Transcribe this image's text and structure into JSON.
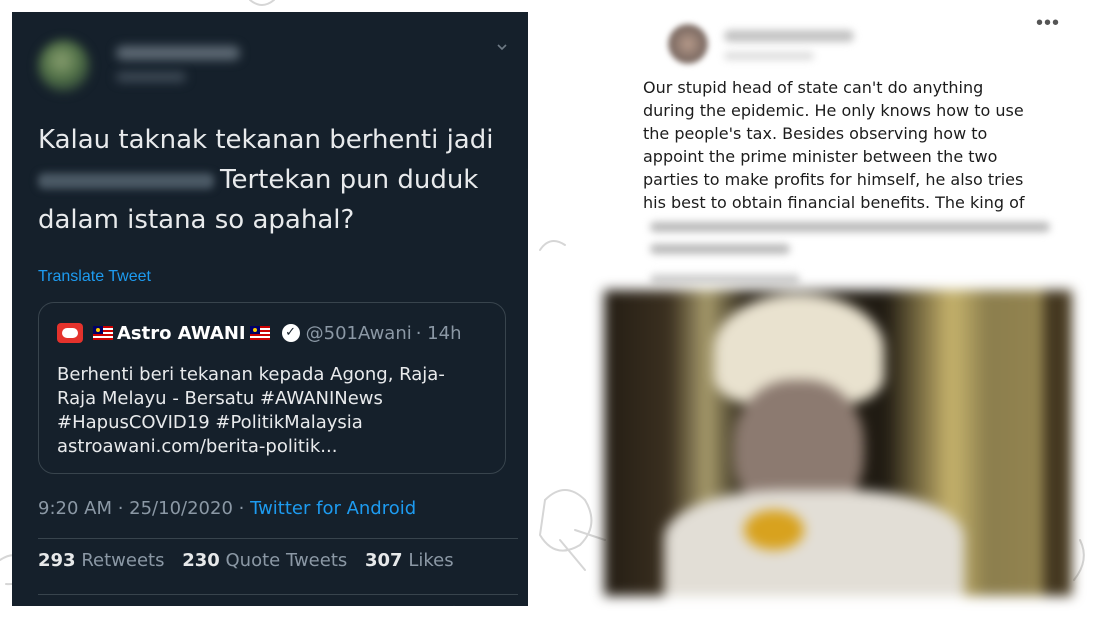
{
  "tweet": {
    "text_line1": "Kalau taknak tekanan berhenti jadi",
    "text_line2": "Tertekan pun duduk",
    "text_line3": "dalam istana so apahal?",
    "translate_label": "Translate Tweet",
    "quoted": {
      "name": "Astro AWANI",
      "handle": "@501Awani",
      "time": "· 14h",
      "body_line1": "Berhenti beri tekanan kepada Agong, Raja-",
      "body_line2": "Raja Melayu - Bersatu #AWANINews",
      "body_line3": "#HapusCOVID19 #PolitikMalaysia",
      "body_line4": "astroawani.com/berita-politik..."
    },
    "timestamp": "9:20 AM · 25/10/2020 · ",
    "source": "Twitter for Android",
    "stats": {
      "retweets_count": "293",
      "retweets_label": "Retweets",
      "quotes_count": "230",
      "quotes_label": "Quote Tweets",
      "likes_count": "307",
      "likes_label": "Likes"
    },
    "colors": {
      "background": "#15202b",
      "accent": "#1d9bf0"
    },
    "icons": [
      "chevron-down-icon",
      "reply-icon",
      "retweet-icon",
      "like-icon",
      "share-icon",
      "verified-icon",
      "malaysia-flag-icon"
    ]
  },
  "fb_post": {
    "more_label": "•••",
    "lines": [
      "Our stupid head of state can't do anything",
      "during the epidemic. He only knows how to use",
      "the people's tax. Besides observing how to",
      "appoint the prime minister between the two",
      "parties to make profits for himself, he also tries",
      "his best to obtain financial benefits. The king of"
    ]
  }
}
